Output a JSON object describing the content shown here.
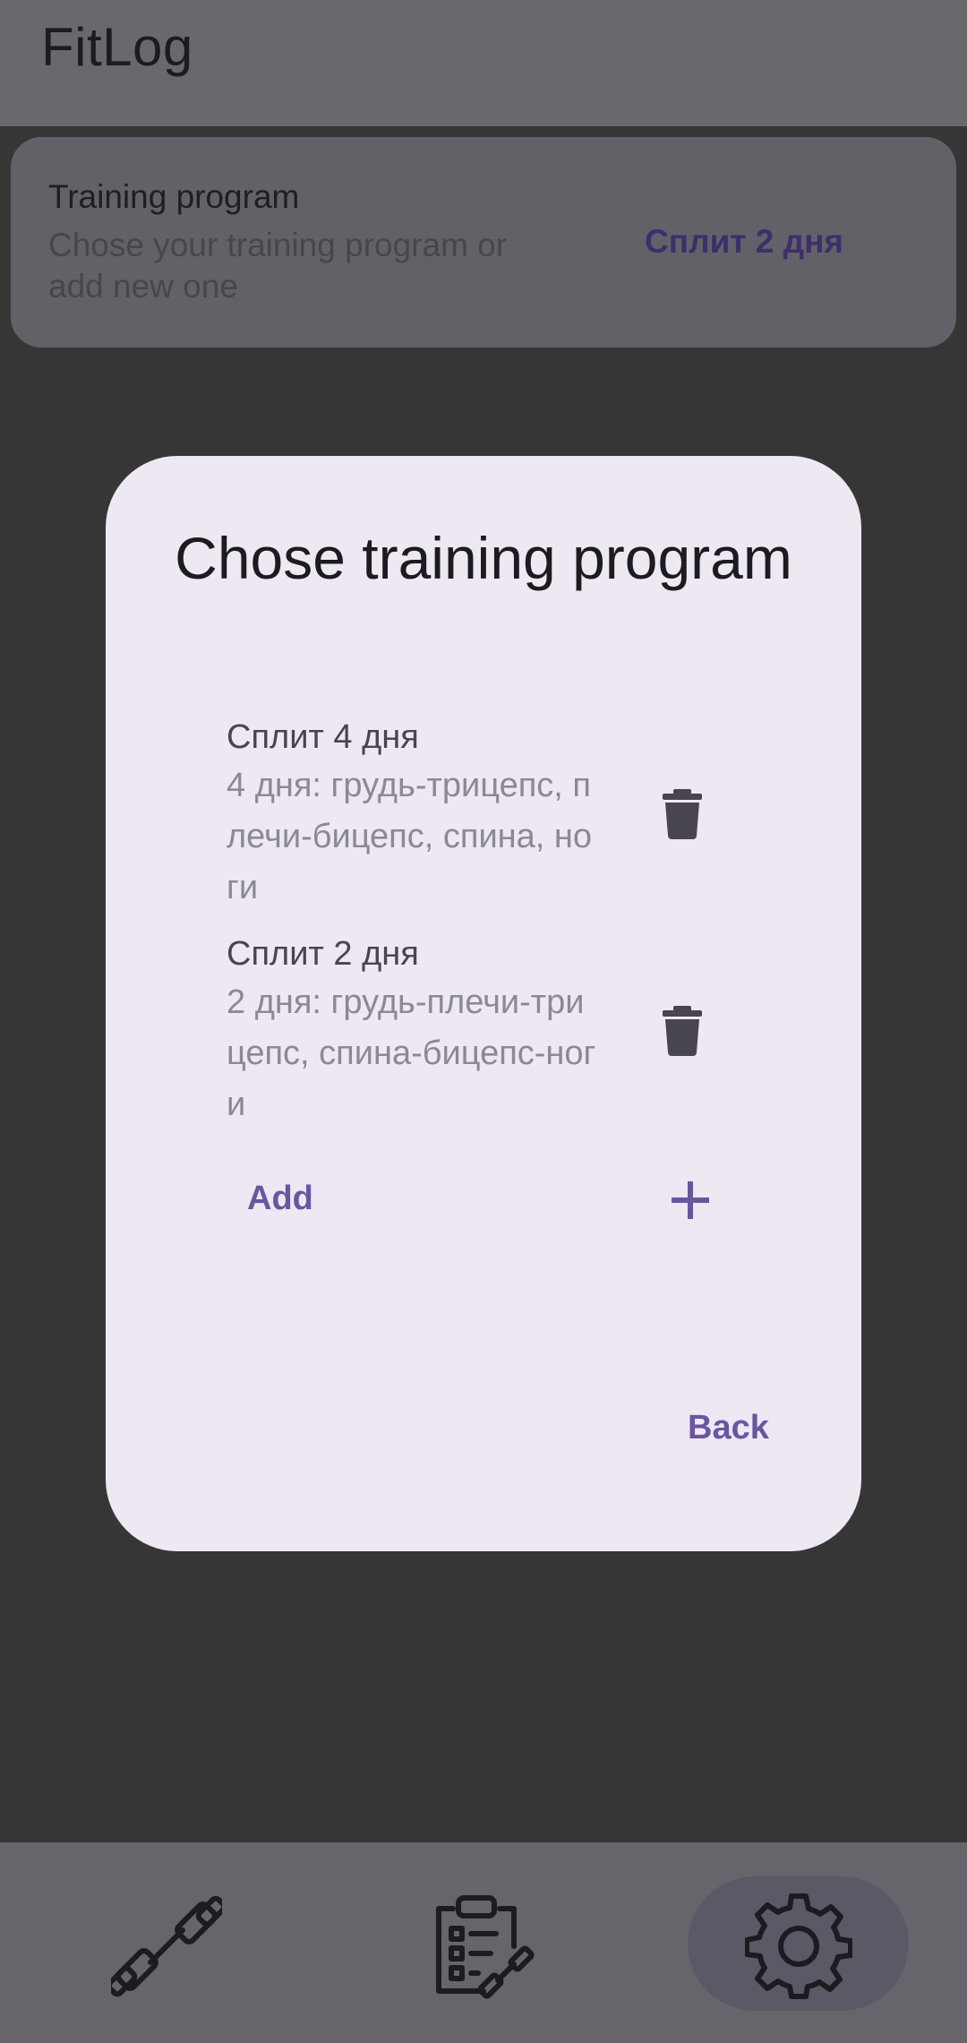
{
  "app": {
    "title": "FitLog"
  },
  "settings": {
    "title": "Training program",
    "description": "Chose your training program or add new one",
    "value": "Сплит 2 дня"
  },
  "dialog": {
    "title": "Chose training program",
    "programs": [
      {
        "name": "Сплит 4 дня",
        "description": "4 дня: грудь-трицепс, плечи-бицепс, спина, ноги"
      },
      {
        "name": "Сплит 2 дня",
        "description": "2 дня: грудь-плечи-трицепс, спина-бицепс-ноги"
      }
    ],
    "add_label": "Add",
    "back_label": "Back"
  },
  "nav": {
    "items": [
      {
        "icon": "dumbbell-icon",
        "active": false
      },
      {
        "icon": "clipboard-workout-icon",
        "active": false
      },
      {
        "icon": "gear-icon",
        "active": true
      }
    ]
  },
  "colors": {
    "accent": "#6a55a2",
    "dialog_bg": "#ede8f1",
    "scrim": "#363636"
  }
}
